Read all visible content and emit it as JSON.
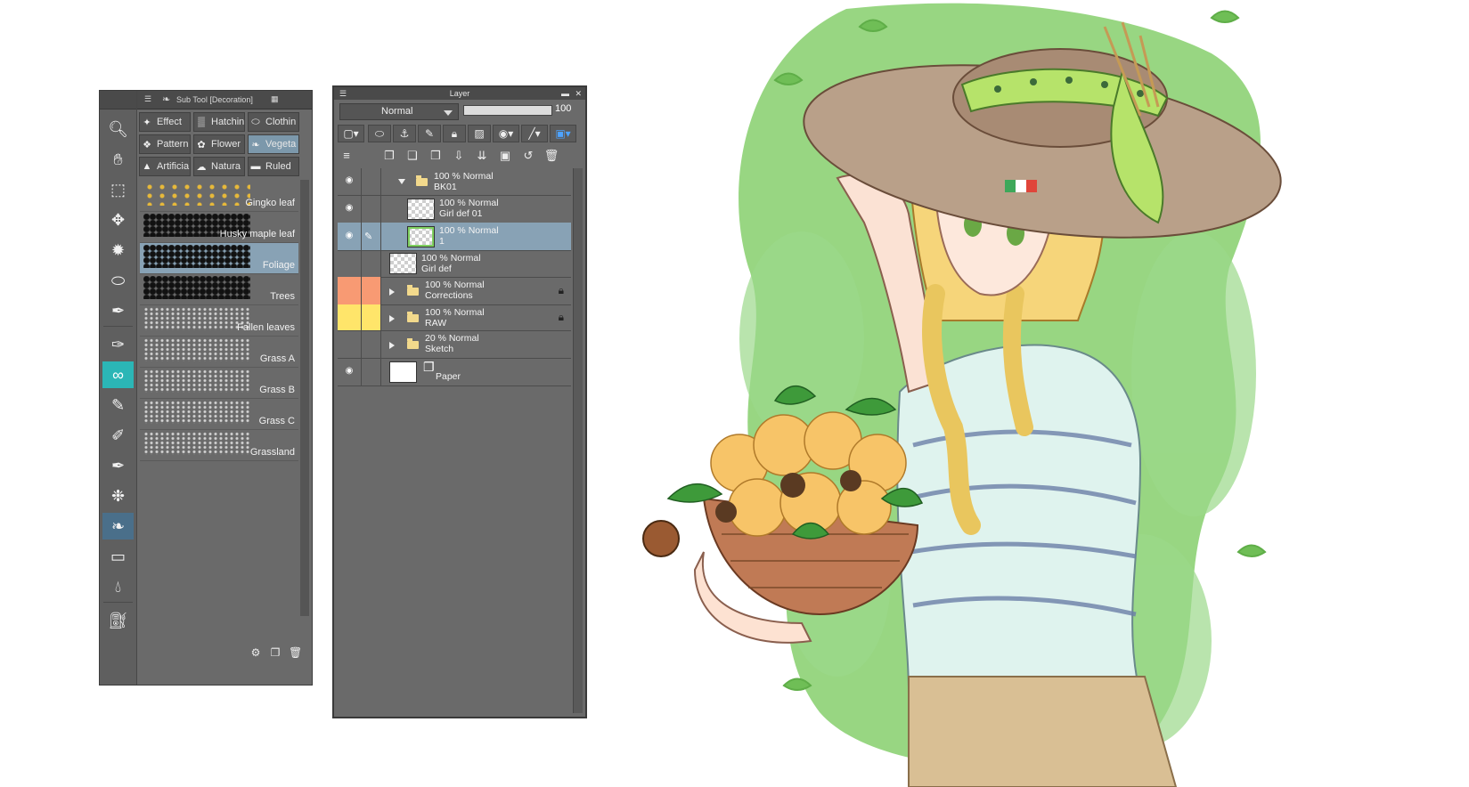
{
  "subtool_panel": {
    "title": "Sub Tool [Decoration]",
    "categories": [
      {
        "label": "Effect",
        "icon": "sparkle-icon"
      },
      {
        "label": "Hatchin",
        "icon": "hatching-icon"
      },
      {
        "label": "Clothin",
        "icon": "clothing-icon"
      },
      {
        "label": "Pattern",
        "icon": "pattern-icon"
      },
      {
        "label": "Flower",
        "icon": "flower-icon"
      },
      {
        "label": "Vegeta",
        "icon": "vegetation-icon",
        "selected": true
      },
      {
        "label": "Artificia",
        "icon": "artificial-icon"
      },
      {
        "label": "Natura",
        "icon": "nature-icon"
      },
      {
        "label": "Ruled",
        "icon": "ruled-icon"
      }
    ],
    "brushes": [
      {
        "label": "Gingko leaf"
      },
      {
        "label": "Husky maple leaf"
      },
      {
        "label": "Foliage",
        "selected": true
      },
      {
        "label": "Trees"
      },
      {
        "label": "Fallen leaves"
      },
      {
        "label": "Grass A"
      },
      {
        "label": "Grass B"
      },
      {
        "label": "Grass C"
      },
      {
        "label": "Grassland"
      }
    ]
  },
  "layer_panel": {
    "title": "Layer",
    "blend_mode": "Normal",
    "opacity": "100",
    "opacity_fraction": 1.0,
    "layers": [
      {
        "line1": "100 % Normal",
        "line2": "BK01",
        "type": "folder",
        "expanded": true,
        "visible": true,
        "indent": 1
      },
      {
        "line1": "100 % Normal",
        "line2": "Girl def 01",
        "type": "raster",
        "visible": true,
        "indent": 2
      },
      {
        "line1": "100 % Normal",
        "line2": "1",
        "type": "raster",
        "visible": true,
        "selected": true,
        "indent": 2
      },
      {
        "line1": "100 % Normal",
        "line2": "Girl def",
        "type": "raster",
        "visible": false,
        "indent": 0
      },
      {
        "line1": "100 % Normal",
        "line2": "Corrections",
        "type": "folder",
        "expanded": false,
        "locked": true,
        "color": "#f89a73",
        "indent": 0
      },
      {
        "line1": "100 % Normal",
        "line2": "RAW",
        "type": "folder",
        "expanded": false,
        "locked": true,
        "color": "#ffe56a",
        "indent": 0
      },
      {
        "line1": "20 % Normal",
        "line2": "Sketch",
        "type": "folder",
        "expanded": false,
        "indent": 0
      },
      {
        "line1": "",
        "line2": "Paper",
        "type": "paper",
        "visible": true,
        "indent": 0
      }
    ]
  },
  "colors": {
    "panel_bg": "#6a6a6a",
    "selection": "#88a2b5",
    "corrections_tag": "#f89a73",
    "raw_tag": "#ffe56a",
    "foliage_green": "#7cc462"
  }
}
